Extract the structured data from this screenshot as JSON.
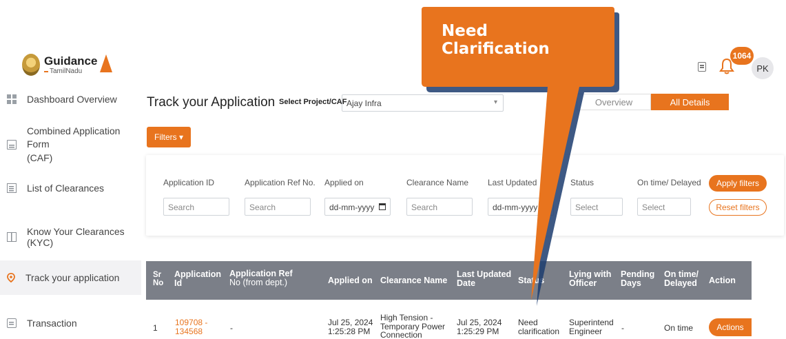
{
  "header": {
    "brand_name": "Guidance",
    "brand_sub": "TamilNadu",
    "notification_count": "1064",
    "user_initials": "PK"
  },
  "sidebar": {
    "items": [
      {
        "label": "Dashboard Overview",
        "icon": "dashboard-icon"
      },
      {
        "label_1": "Combined Application Form",
        "label_2": "(CAF)",
        "icon": "document-icon"
      },
      {
        "label": "List of Clearances",
        "icon": "list-icon"
      },
      {
        "label": "Know Your Clearances (KYC)",
        "icon": "book-icon"
      },
      {
        "label": "Track your application",
        "icon": "location-pin-icon",
        "active": true
      },
      {
        "label": "Transaction",
        "icon": "transaction-icon"
      }
    ]
  },
  "main": {
    "title": "Track your Application",
    "project_label": "Select Project/CAF",
    "project_value": "Ajay Infra",
    "tabs": {
      "overview": "Overview",
      "all_details": "All Details"
    },
    "filters_button": "Filters ▾"
  },
  "filters": {
    "labels": {
      "application_id": "Application ID",
      "application_ref": "Application Ref No.",
      "applied_on": "Applied on",
      "clearance_name": "Clearance Name",
      "last_updated": "Last Updated",
      "status": "Status",
      "on_time": "On time/ Delayed"
    },
    "placeholders": {
      "application_id": "Search",
      "application_ref": "Search",
      "applied_on": "dd-mm-yyyy",
      "clearance_name": "Search",
      "last_updated": "dd-mm-yyyy",
      "status": "Select",
      "on_time": "Select"
    },
    "apply_label": "Apply filters",
    "reset_label": "Reset filters"
  },
  "table": {
    "headers": {
      "sr_1": "Sr",
      "sr_2": "No",
      "app_id_1": "Application",
      "app_id_2": "Id",
      "app_ref_1": "Application Ref",
      "app_ref_2": "No (from dept.)",
      "applied_on": "Applied on",
      "clearance_name": "Clearance Name",
      "last_updated_1": "Last Updated",
      "last_updated_2": "Date",
      "status": "Status",
      "lying_1": "Lying with",
      "lying_2": "Officer",
      "pending_1": "Pending",
      "pending_2": "Days",
      "ontime_1": "On time/",
      "ontime_2": "Delayed",
      "action": "Action"
    },
    "rows": [
      {
        "sr": "1",
        "app_id_1": "109708 -",
        "app_id_2": "134568",
        "app_ref": "-",
        "applied_1": "Jul 25, 2024",
        "applied_2": "1:25:28 PM",
        "clearance_1": "High Tension -",
        "clearance_2": "Temporary Power",
        "clearance_3": "Connection",
        "updated_1": "Jul 25, 2024",
        "updated_2": "1:25:29 PM",
        "status_1": "Need",
        "status_2": "clarification",
        "officer_1": "Superintend",
        "officer_2": "Engineer",
        "pending": "-",
        "ontime": "On time",
        "action": "Actions"
      }
    ]
  },
  "callout": {
    "line_1": "Need",
    "line_2": "Clarification",
    "color": "#e8741e"
  }
}
